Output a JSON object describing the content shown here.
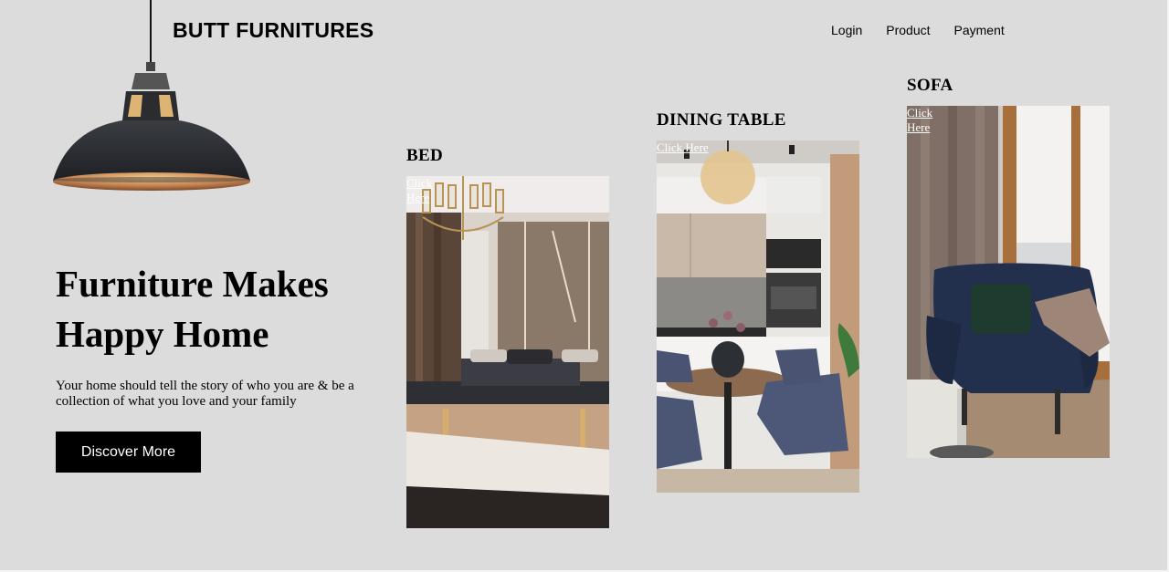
{
  "header": {
    "brand": "BUTT FURNITURES",
    "nav": [
      "Login",
      "Product",
      "Payment"
    ]
  },
  "hero": {
    "title_line1": "Furniture Makes",
    "title_line2": "Happy Home",
    "subtitle_line1": "Your home should tell the story of who you are & be a",
    "subtitle_line2": "collection of what you love and your family",
    "cta": "Discover More"
  },
  "products": [
    {
      "title": "BED",
      "link": "Click Here"
    },
    {
      "title": "DINING TABLE",
      "link": "Click Here"
    },
    {
      "title": "SOFA",
      "link": "Click Here"
    }
  ],
  "colors": {
    "background": "#dcdcdc",
    "button": "#000000",
    "button_text": "#ffffff"
  }
}
